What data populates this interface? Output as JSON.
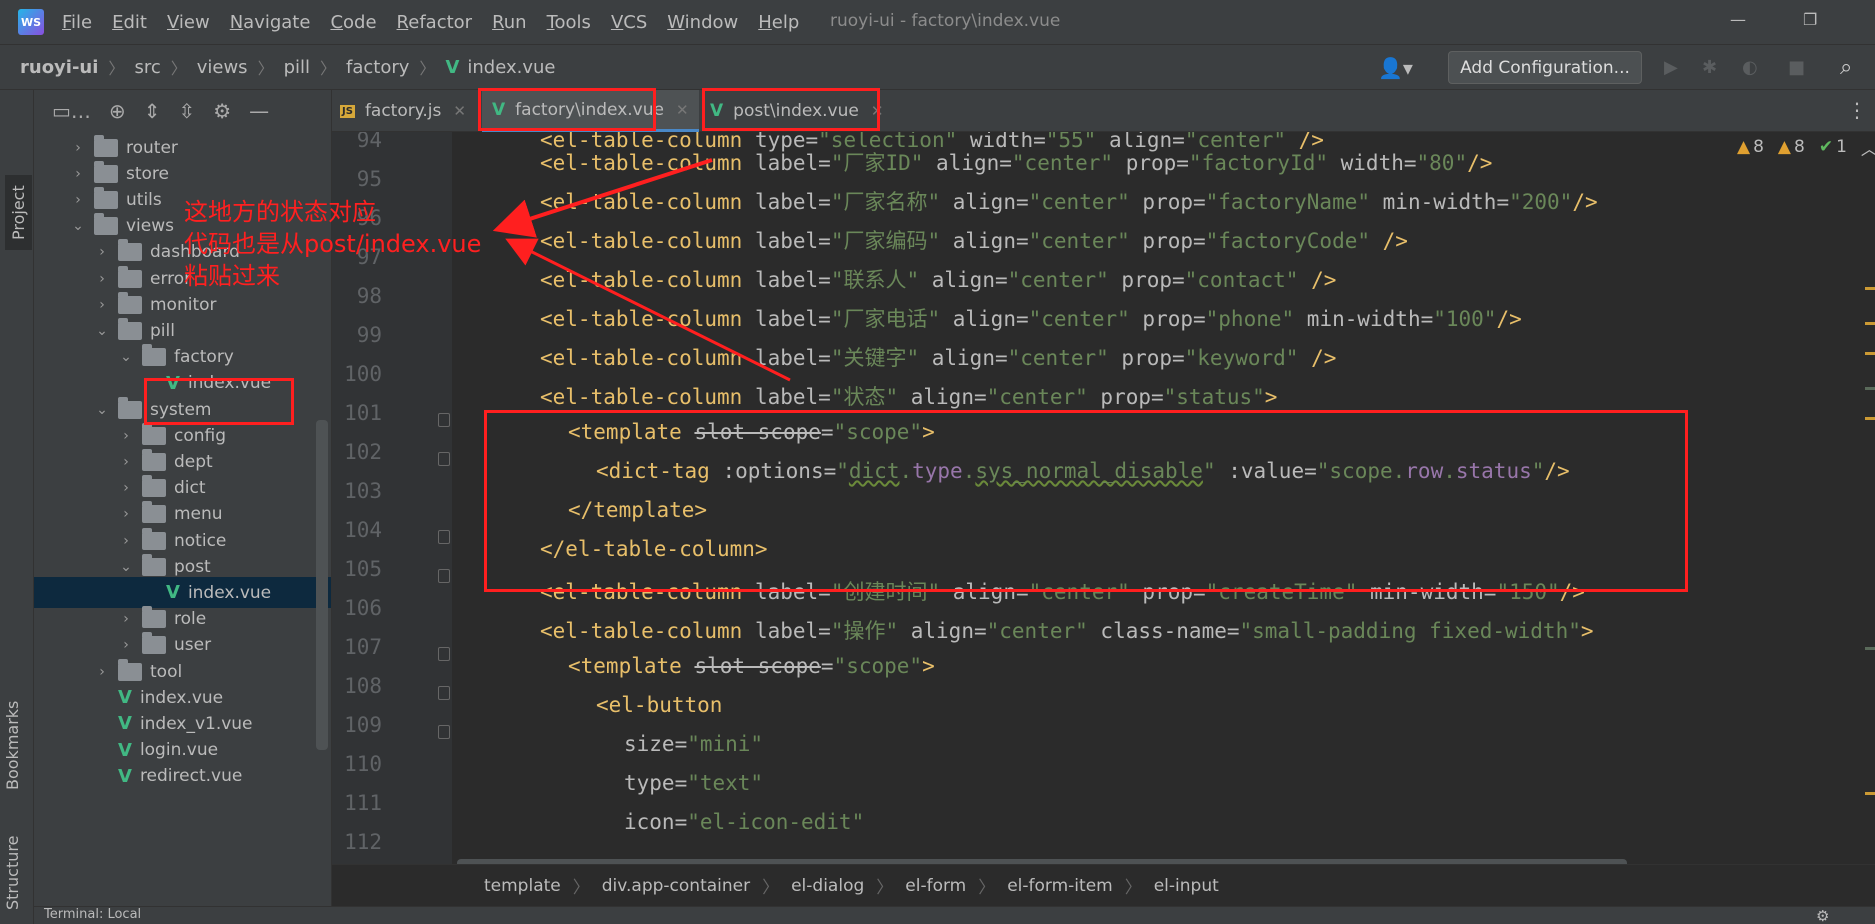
{
  "app": {
    "logo": "WS",
    "window_title": "ruoyi-ui - factory\\index.vue",
    "menu": [
      "File",
      "Edit",
      "View",
      "Navigate",
      "Code",
      "Refactor",
      "Run",
      "Tools",
      "VCS",
      "Window",
      "Help"
    ]
  },
  "nav": {
    "breadcrumb": [
      "ruoyi-ui",
      "src",
      "views",
      "pill",
      "factory",
      "index.vue"
    ],
    "add_configuration": "Add Configuration..."
  },
  "side_tabs": {
    "project": "Project",
    "bookmarks": "Bookmarks",
    "structure": "Structure"
  },
  "tree": [
    {
      "indent": 1,
      "type": "folder",
      "label": "router",
      "open": false
    },
    {
      "indent": 1,
      "type": "folder",
      "label": "store",
      "open": false
    },
    {
      "indent": 1,
      "type": "folder",
      "label": "utils",
      "open": false
    },
    {
      "indent": 1,
      "type": "folder",
      "label": "views",
      "open": true
    },
    {
      "indent": 2,
      "type": "folder",
      "label": "dashboard",
      "open": false
    },
    {
      "indent": 2,
      "type": "folder",
      "label": "error",
      "open": false
    },
    {
      "indent": 2,
      "type": "folder",
      "label": "monitor",
      "open": false
    },
    {
      "indent": 2,
      "type": "folder",
      "label": "pill",
      "open": true
    },
    {
      "indent": 3,
      "type": "folder",
      "label": "factory",
      "open": true
    },
    {
      "indent": 4,
      "type": "vue",
      "label": "index.vue"
    },
    {
      "indent": 2,
      "type": "folder",
      "label": "system",
      "open": true
    },
    {
      "indent": 3,
      "type": "folder",
      "label": "config",
      "open": false
    },
    {
      "indent": 3,
      "type": "folder",
      "label": "dept",
      "open": false
    },
    {
      "indent": 3,
      "type": "folder",
      "label": "dict",
      "open": false
    },
    {
      "indent": 3,
      "type": "folder",
      "label": "menu",
      "open": false
    },
    {
      "indent": 3,
      "type": "folder",
      "label": "notice",
      "open": false
    },
    {
      "indent": 3,
      "type": "folder",
      "label": "post",
      "open": true
    },
    {
      "indent": 4,
      "type": "vue",
      "label": "index.vue",
      "selected": true
    },
    {
      "indent": 3,
      "type": "folder",
      "label": "role",
      "open": false
    },
    {
      "indent": 3,
      "type": "folder",
      "label": "user",
      "open": false
    },
    {
      "indent": 2,
      "type": "folder",
      "label": "tool",
      "open": false
    },
    {
      "indent": 2,
      "type": "vue",
      "label": "index.vue"
    },
    {
      "indent": 2,
      "type": "vue",
      "label": "index_v1.vue"
    },
    {
      "indent": 2,
      "type": "vue",
      "label": "login.vue"
    },
    {
      "indent": 2,
      "type": "vue",
      "label": "redirect.vue"
    }
  ],
  "tabs": [
    {
      "label": "factory.js",
      "icon": "js"
    },
    {
      "label": "factory\\index.vue",
      "icon": "vue",
      "active": true
    },
    {
      "label": "post\\index.vue",
      "icon": "vue"
    }
  ],
  "inspections": {
    "warnings_a": "8",
    "warnings_b": "8",
    "ok": "1"
  },
  "code": {
    "line_numbers": [
      "94",
      "95",
      "96",
      "97",
      "98",
      "99",
      "100",
      "101",
      "102",
      "103",
      "104",
      "105",
      "106",
      "107",
      "108",
      "109",
      "110",
      "111",
      "112"
    ],
    "line_94": {
      "tag": "<el-table-column",
      "attrs": " type=",
      "v1": "\"selection\"",
      "a2": " width=",
      "v2": "\"55\"",
      "a3": " align=",
      "v3": "\"center\"",
      "end": " />"
    },
    "col_label": " label=",
    "col_align": " align=",
    "col_prop": " prop=",
    "center": "\"center\"",
    "line_95": {
      "label": "\"厂家ID\"",
      "prop": "\"factoryId\"",
      "extra_attr": " width=",
      "extra_val": "\"80\"",
      "end": "/>"
    },
    "line_96": {
      "label": "\"厂家名称\"",
      "prop": "\"factoryName\"",
      "extra_attr": " min-width=",
      "extra_val": "\"200\"",
      "end": "/>"
    },
    "line_97": {
      "label": "\"厂家编码\"",
      "prop": "\"factoryCode\"",
      "end": " />"
    },
    "line_98": {
      "label": "\"联系人\"",
      "prop": "\"contact\"",
      "end": " />"
    },
    "line_99": {
      "label": "\"厂家电话\"",
      "prop": "\"phone\"",
      "extra_attr": " min-width=",
      "extra_val": "\"100\"",
      "end": "/>"
    },
    "line_100": {
      "label": "\"关键字\"",
      "prop": "\"keyword\"",
      "end": " />"
    },
    "line_101": {
      "label": "\"状态\"",
      "prop": "\"status\"",
      "end": ">"
    },
    "template_open": "<template",
    "slot_scope": "slot-scope",
    "eq": "=",
    "scope_val": "\"scope\"",
    "gt": ">",
    "line_103": {
      "tag": "<dict-tag",
      "attr1": " :options=",
      "q": "\"",
      "dict": "dict",
      "dot": ".",
      "type": "type",
      "dot2": ".",
      "sys": "sys_normal_disable",
      "q2": "\"",
      "attr2": " :value=",
      "q3": "\"",
      "scope": "scope",
      "dot3": ".",
      "row": "row",
      "dot4": ".",
      "status": "status",
      "q4": "\"",
      "end": "/>"
    },
    "template_close": "</template>",
    "col_close": "</el-table-column>",
    "line_106": {
      "label": "\"创建时间\"",
      "prop": "\"createTime\"",
      "extra_attr": " min-width=",
      "extra_val": "\"150\"",
      "end": "/>"
    },
    "line_107": {
      "label": "\"操作\"",
      "class_attr": " class-name=",
      "class_val": "\"small-padding fixed-width\"",
      "end": ">"
    },
    "el_button": "<el-button",
    "size_attr": "size=",
    "size_val": "\"mini\"",
    "type_attr": "type=",
    "type_val": "\"text\"",
    "icon_attr": "icon=",
    "icon_val": "\"el-icon-edit\""
  },
  "editor_crumbs": [
    "template",
    "div.app-container",
    "el-dialog",
    "el-form",
    "el-form-item",
    "el-input"
  ],
  "bottom": {
    "label": "Terminal: Local"
  },
  "annotation": {
    "lines": [
      "这地方的状态对应",
      "代码也是从post/index.vue",
      "粘贴过来"
    ],
    "color": "#ff2020"
  }
}
